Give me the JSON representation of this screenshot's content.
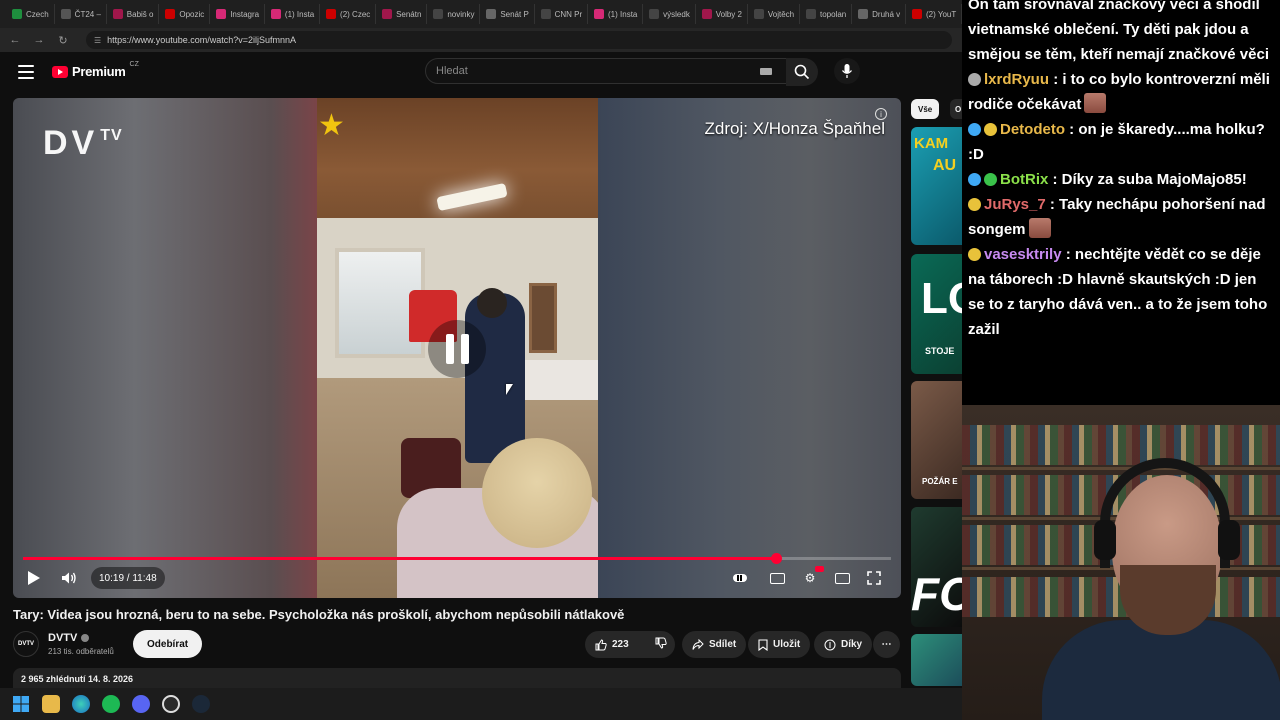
{
  "browser": {
    "tabs": [
      {
        "label": "Czech",
        "color": "#1e8e3e"
      },
      {
        "label": "ČT24 –",
        "color": "#555555"
      },
      {
        "label": "Babiš o",
        "color": "#a0174b"
      },
      {
        "label": "Opozic",
        "color": "#cc0000"
      },
      {
        "label": "Instagra",
        "color": "#d62976"
      },
      {
        "label": "(1) Insta",
        "color": "#d62976"
      },
      {
        "label": "(2) Czec",
        "color": "#cc0000"
      },
      {
        "label": "Senátn",
        "color": "#a0174b"
      },
      {
        "label": "novinky",
        "color": "#444444"
      },
      {
        "label": "Senát P",
        "color": "#666666"
      },
      {
        "label": "CNN Pr",
        "color": "#444444"
      },
      {
        "label": "(1) Insta",
        "color": "#d62976"
      },
      {
        "label": "výsledk",
        "color": "#444444"
      },
      {
        "label": "Volby 2",
        "color": "#a0174b"
      },
      {
        "label": "Vojtěch",
        "color": "#444444"
      },
      {
        "label": "topolan",
        "color": "#444444"
      },
      {
        "label": "Druhá v",
        "color": "#666666"
      },
      {
        "label": "(2) YouT",
        "color": "#cc0000"
      }
    ],
    "url": "https://www.youtube.com/watch?v=2iljSufmnnA"
  },
  "header": {
    "logo_text": "Premium",
    "logo_country": "CZ",
    "search_placeholder": "Hledat"
  },
  "player": {
    "overlay_logo": "DV",
    "overlay_logo_sup": "TV",
    "source_label": "Zdroj: X/Honza Špaňhel",
    "time": "10:19 / 11:48",
    "progress": 0.867
  },
  "video": {
    "title": "Tary: Videa jsou hrozná, beru to na sebe. Psycholožka nás proškolí, abychom nepůsobili nátlakově",
    "channel_avatar_text": "DVTV",
    "channel_name": "DVTV",
    "subscribers": "213 tis. odběratelů",
    "subscribe_label": "Odebírat",
    "likes": "223",
    "share_label": "Sdílet",
    "save_label": "Uložit",
    "thanks_label": "Díky",
    "meta": "2 965 zhlédnutí  14. 8. 2026"
  },
  "sidebar": {
    "chip_all": "Vše",
    "chip_next": "O",
    "thumb_labels": [
      "KAM",
      "AU",
      "LO",
      "STOJE",
      "POŽÁR E",
      "FO"
    ]
  },
  "chat": {
    "lines": [
      {
        "user": "",
        "color": "#ffffff",
        "text": "On tam srovnával značkový věci a shodil vietnamské oblečení. Ty děti pak jdou a smějou se těm, kteří nemají značkové věci"
      },
      {
        "user": "lxrdRyuu",
        "color": "#e8b84a",
        "text": ": i to co bylo kontroverzní měli rodiče očekávat"
      },
      {
        "user": "Detodeto",
        "color": "#e8b84a",
        "text": ": on je škaredy....ma holku? :D"
      },
      {
        "user": "BotRix",
        "color": "#8be04a",
        "text": ": Díky za suba MajoMajo85!"
      },
      {
        "user": "JuRys_7",
        "color": "#e06a6a",
        "text": ": Taky nechápu pohoršení nad songem"
      },
      {
        "user": "vasesktrily",
        "color": "#c78af0",
        "text": ": nechtějte vědět co se děje na táborech :D hlavně skautských :D jen se to z taryho dává ven.. a to že jsem toho zažil"
      }
    ]
  },
  "colors": {
    "accent": "#ff0033",
    "background": "#0f0f0f"
  }
}
